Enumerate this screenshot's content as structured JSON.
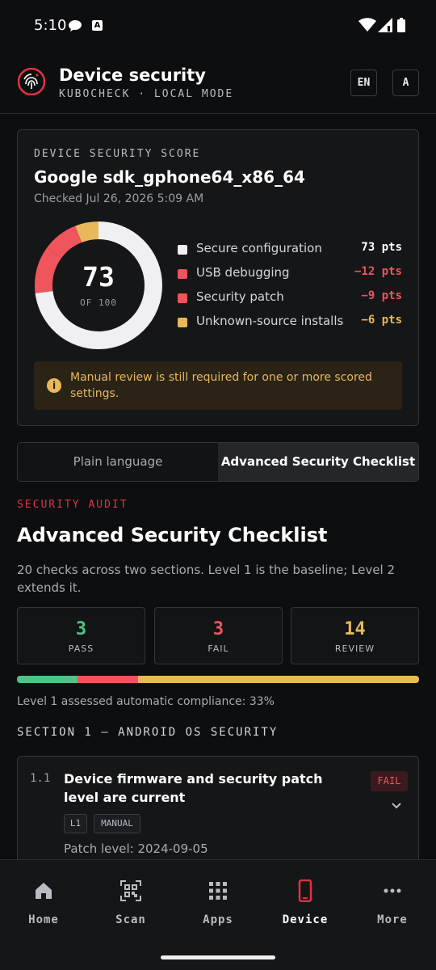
{
  "status_bar": {
    "time": "5:10"
  },
  "header": {
    "title": "Device security",
    "subtitle": "KUBOCHECK · LOCAL MODE",
    "lang_button": "EN",
    "text_button": "A"
  },
  "score_card": {
    "label": "DEVICE SECURITY SCORE",
    "device": "Google sdk_gphone64_x86_64",
    "checked": "Checked Jul 26, 2026 5:09 AM",
    "score": "73",
    "score_of": "OF 100",
    "legend": [
      {
        "label": "Secure configuration",
        "value": "73 pts",
        "color": "#f0f0f2",
        "value_color": "#ffffff"
      },
      {
        "label": "USB debugging",
        "value": "−12 pts",
        "color": "#f0545d",
        "value_color": "#f0545d"
      },
      {
        "label": "Security patch",
        "value": "−9 pts",
        "color": "#f0545d",
        "value_color": "#f0545d"
      },
      {
        "label": "Unknown-source installs",
        "value": "−6 pts",
        "color": "#e8b85a",
        "value_color": "#e8b85a"
      }
    ],
    "notice": "Manual review is still required for one or more scored settings."
  },
  "tabs": {
    "plain": "Plain language",
    "advanced": "Advanced Security Checklist",
    "active": "advanced"
  },
  "audit": {
    "kicker": "SECURITY AUDIT",
    "title": "Advanced Security Checklist",
    "description": "20 checks across two sections. Level 1 is the baseline; Level 2 extends it.",
    "stats": [
      {
        "value": "3",
        "label": "PASS",
        "color": "#4fc38a"
      },
      {
        "value": "3",
        "label": "FAIL",
        "color": "#f0545d"
      },
      {
        "value": "14",
        "label": "REVIEW",
        "color": "#e8b85a"
      }
    ],
    "compliance": "Level 1 assessed automatic compliance: 33%",
    "section_heading": "SECTION 1 — ANDROID OS SECURITY"
  },
  "items": [
    {
      "number": "1.1",
      "title": "Device firmware and security patch level are current",
      "status": "FAIL",
      "tags": [
        "L1",
        "MANUAL"
      ],
      "detail": "Patch level: 2024-09-05"
    }
  ],
  "nav": {
    "items": [
      {
        "label": "Home",
        "icon": "home-icon"
      },
      {
        "label": "Scan",
        "icon": "qr-scan-icon"
      },
      {
        "label": "Apps",
        "icon": "apps-grid-icon"
      },
      {
        "label": "Device",
        "icon": "phone-icon"
      },
      {
        "label": "More",
        "icon": "more-dots-icon"
      }
    ],
    "active": "Device"
  },
  "colors": {
    "accent": "#e0333f",
    "pass": "#4fc38a",
    "fail": "#f0545d",
    "review": "#e8b85a"
  }
}
